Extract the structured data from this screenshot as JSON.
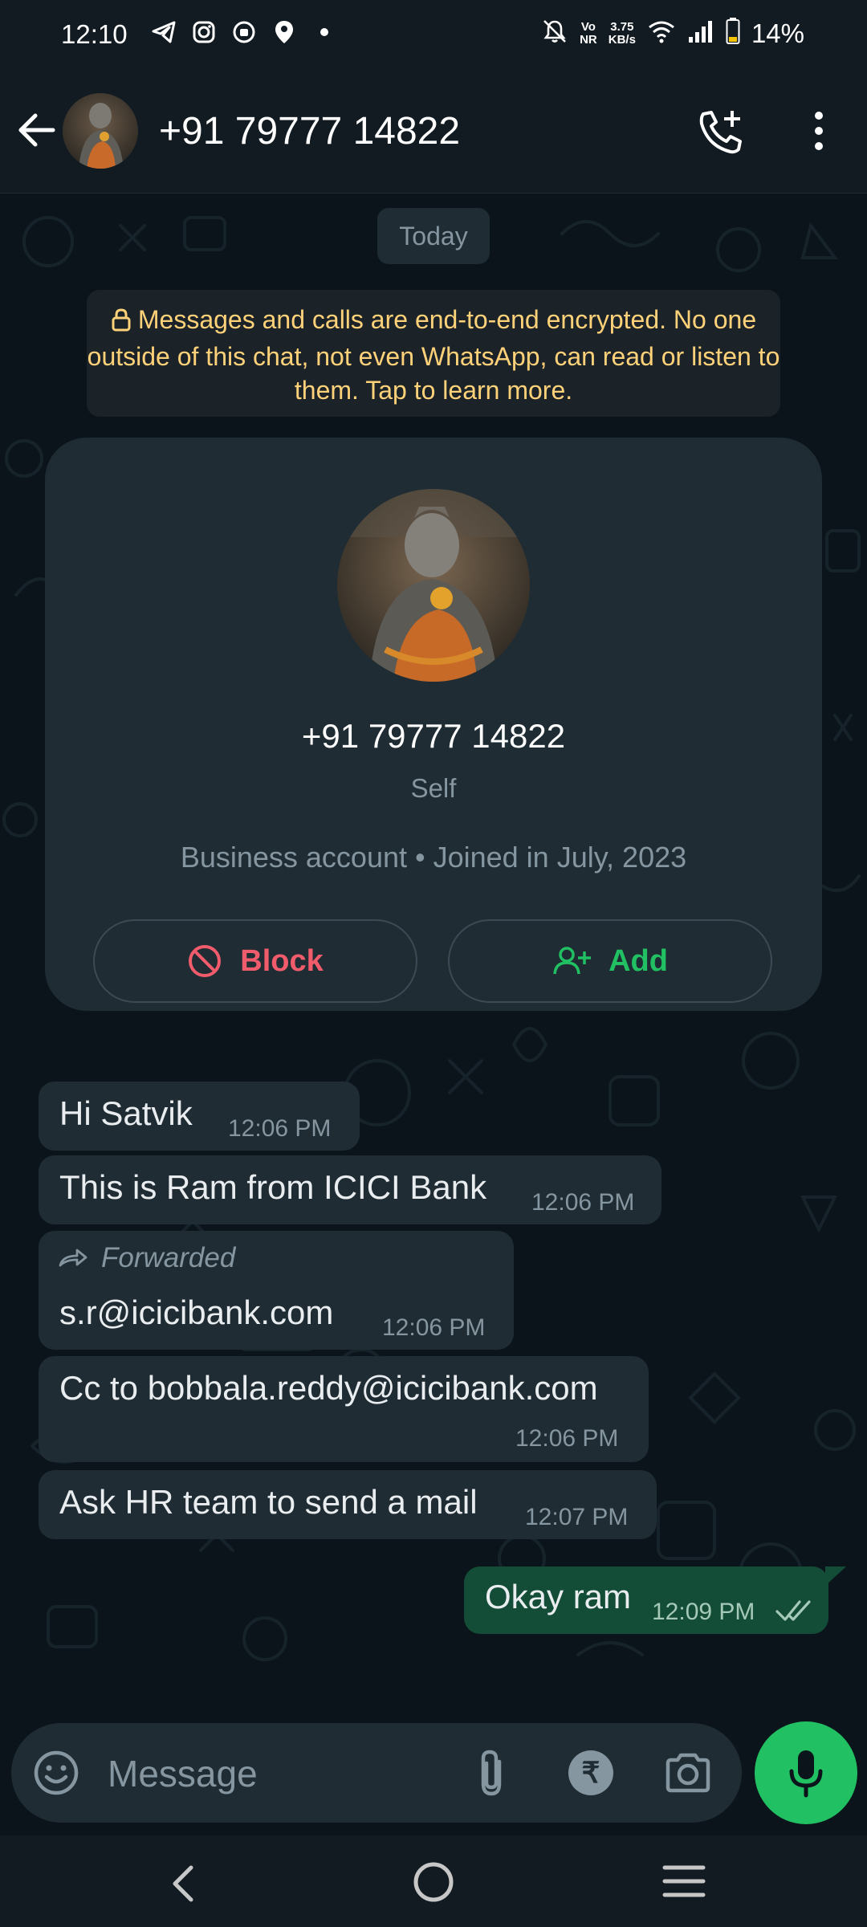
{
  "status_bar": {
    "time": "12:10",
    "network_vo": "Vo",
    "network_nr": "NR",
    "speed_value": "3.75",
    "speed_unit": "KB/s",
    "battery": "14%"
  },
  "header": {
    "title": "+91 79777 14822"
  },
  "chat": {
    "date_pill": "Today",
    "encryption_notice": "Messages and calls are end-to-end encrypted. No one outside of this chat, not even WhatsApp, can read or listen to them. Tap to learn more.",
    "profile_card": {
      "number": "+91 79777 14822",
      "subtitle": "Self",
      "business_info": "Business account • Joined in July, 2023",
      "block_label": "Block",
      "add_label": "Add"
    },
    "messages": [
      {
        "text": "Hi Satvik",
        "time": "12:06 PM"
      },
      {
        "text": "This is Ram from ICICI Bank",
        "time": "12:06 PM"
      },
      {
        "forwarded_label": "Forwarded",
        "text": "s.r@icicibank.com",
        "time": "12:06 PM"
      },
      {
        "text": "Cc to bobbala.reddy@icicibank.com",
        "time": "12:06 PM"
      },
      {
        "text": "Ask HR team to send a mail",
        "time": "12:07 PM"
      },
      {
        "text": "Okay ram",
        "time": "12:09 PM"
      }
    ]
  },
  "input_bar": {
    "placeholder": "Message",
    "rupee_symbol": "₹"
  },
  "colors": {
    "accent_green": "#21c063",
    "block_red": "#f15c6d",
    "encryption_yellow": "#ffd279",
    "outgoing_bubble": "#144d37",
    "incoming_bubble": "#1f2c33"
  }
}
